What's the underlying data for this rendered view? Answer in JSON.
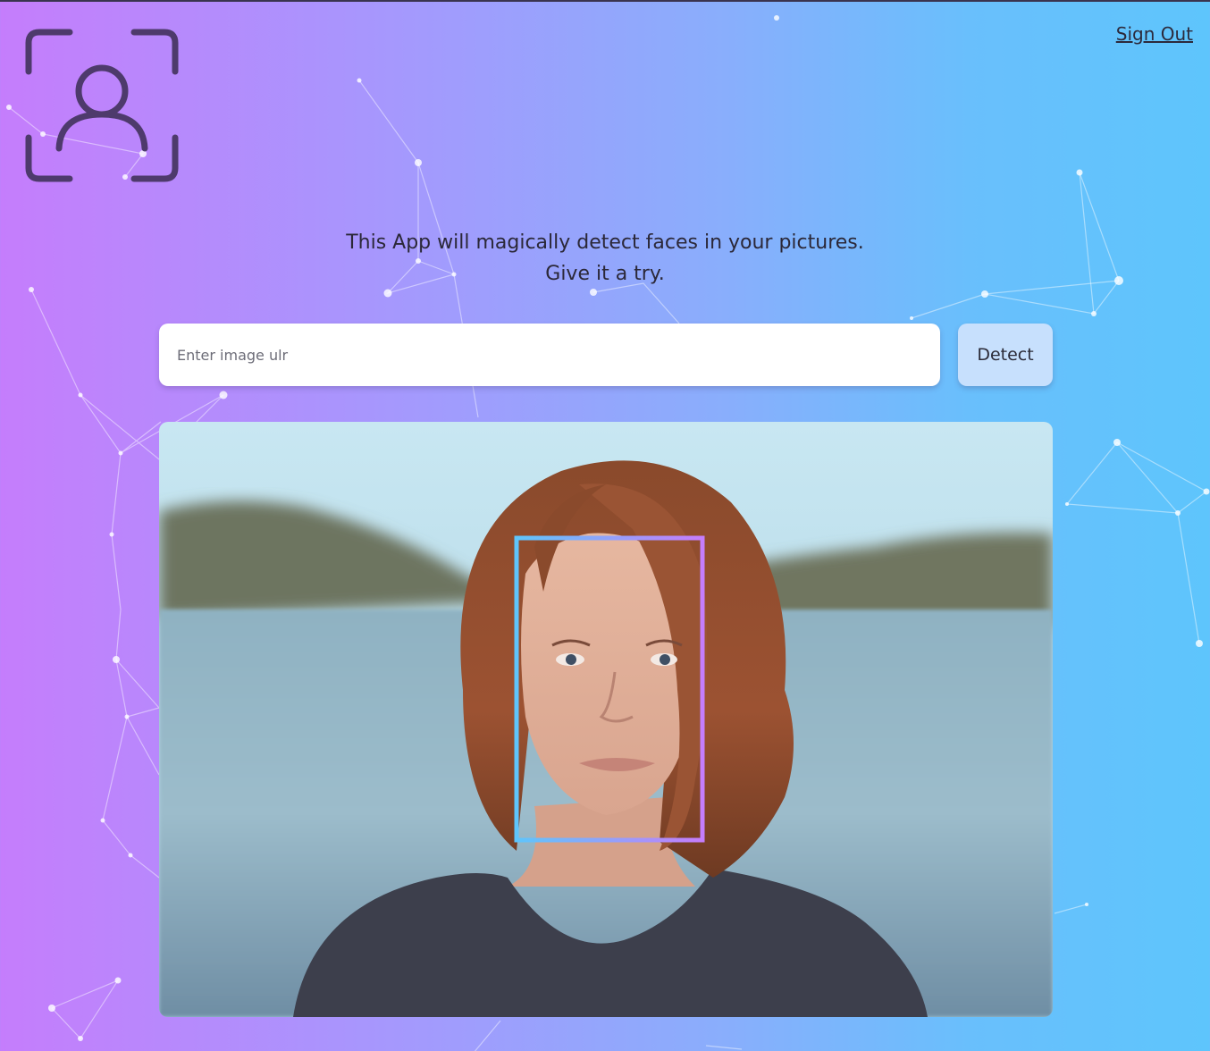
{
  "header": {
    "logo_icon": "face-scan-icon",
    "signout_label": "Sign Out"
  },
  "tagline": {
    "line1": "This App will magically detect faces in your pictures.",
    "line2": "Give it a try."
  },
  "form": {
    "url_placeholder": "Enter image ulr",
    "url_value": "",
    "detect_label": "Detect"
  },
  "result": {
    "image_subject": "portrait-photo",
    "face_box_icon": "face-bounding-box"
  },
  "colors": {
    "gradient_start": "#c57dfc",
    "gradient_end": "#5ec5fc",
    "logo": "#4e3a6c",
    "button_bg": "#c7e0fd",
    "face_box_start": "#5ec5fc",
    "face_box_end": "#c57dfc"
  }
}
